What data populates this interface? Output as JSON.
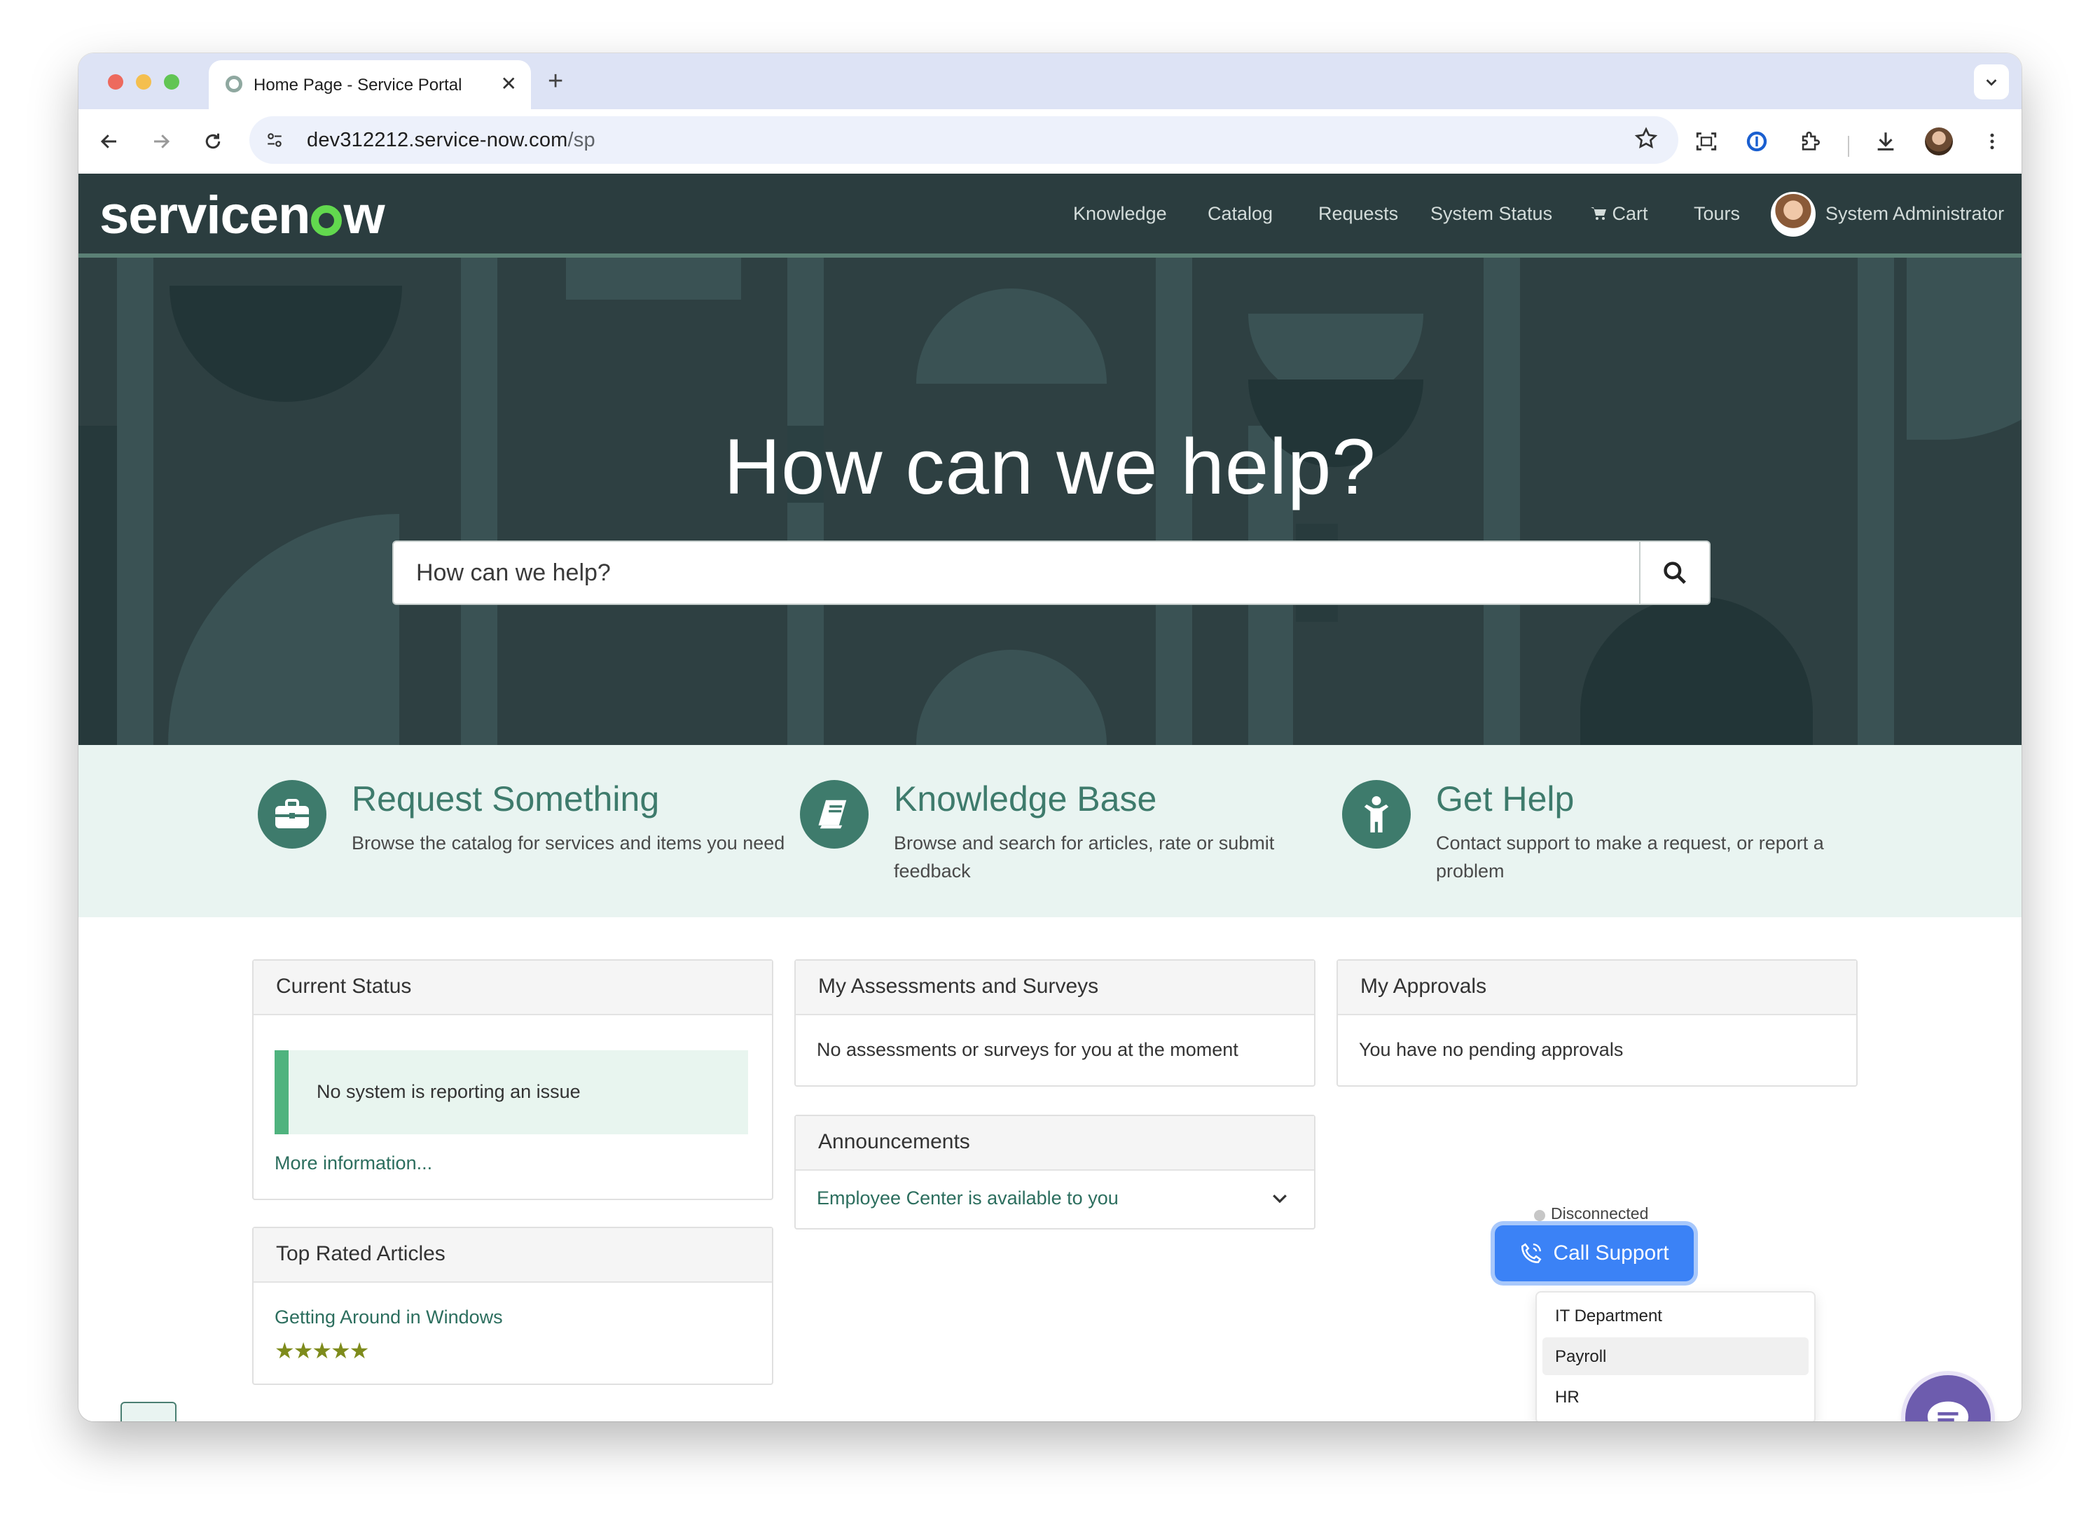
{
  "browser": {
    "tab_title": "Home Page - Service Portal",
    "url_host": "dev312212.service-now.com",
    "url_path": "/sp"
  },
  "header": {
    "logo_text_before": "servicen",
    "logo_text_after": "w",
    "nav": {
      "knowledge": "Knowledge",
      "catalog": "Catalog",
      "requests": "Requests",
      "system_status": "System Status",
      "cart": "Cart",
      "tours": "Tours",
      "user": "System Administrator"
    }
  },
  "hero": {
    "title": "How can we help?",
    "search_placeholder": "How can we help?"
  },
  "quick_links": [
    {
      "title": "Request Something",
      "desc": "Browse the catalog for services and items you need",
      "icon": "briefcase-icon"
    },
    {
      "title": "Knowledge Base",
      "desc": "Browse and search for articles, rate or submit feedback",
      "icon": "book-icon"
    },
    {
      "title": "Get Help",
      "desc": "Contact support to make a request, or report a problem",
      "icon": "person-icon"
    }
  ],
  "panels": {
    "current_status": {
      "title": "Current Status",
      "message": "No system is reporting an issue",
      "more_link": "More information..."
    },
    "top_rated": {
      "title": "Top Rated Articles",
      "article": "Getting Around in Windows",
      "rating_stars": 5
    },
    "assessments": {
      "title": "My Assessments and Surveys",
      "message": "No assessments or surveys for you at the moment"
    },
    "announcements": {
      "title": "Announcements",
      "item": "Employee Center is available to you"
    },
    "approvals": {
      "title": "My Approvals",
      "message": "You have no pending approvals"
    }
  },
  "call_widget": {
    "status": "Disconnected",
    "button_label": "Call Support",
    "options": [
      "IT Department",
      "Payroll",
      "HR"
    ],
    "highlighted_option": "Payroll"
  },
  "colors": {
    "header_bg": "#2b3d3f",
    "accent_green": "#3e7b6c",
    "call_blue": "#3b82f6",
    "chat_purple": "#6d5cae"
  }
}
